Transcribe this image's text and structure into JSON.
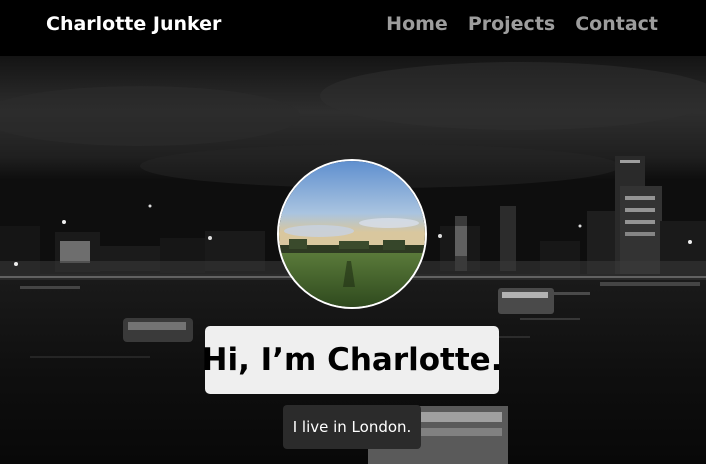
{
  "navbar": {
    "brand": "Charlotte Junker",
    "links": [
      "Home",
      "Projects",
      "Contact"
    ]
  },
  "hero": {
    "headline": "Hi, I’m Charlotte.",
    "subline": "I live in London."
  },
  "colors": {
    "navbar_background": "#000000",
    "nav_link": "#9d9d9d",
    "brand_text": "#ffffff",
    "headline_box": "#efefef",
    "subline_box": "#2b2b2b"
  }
}
